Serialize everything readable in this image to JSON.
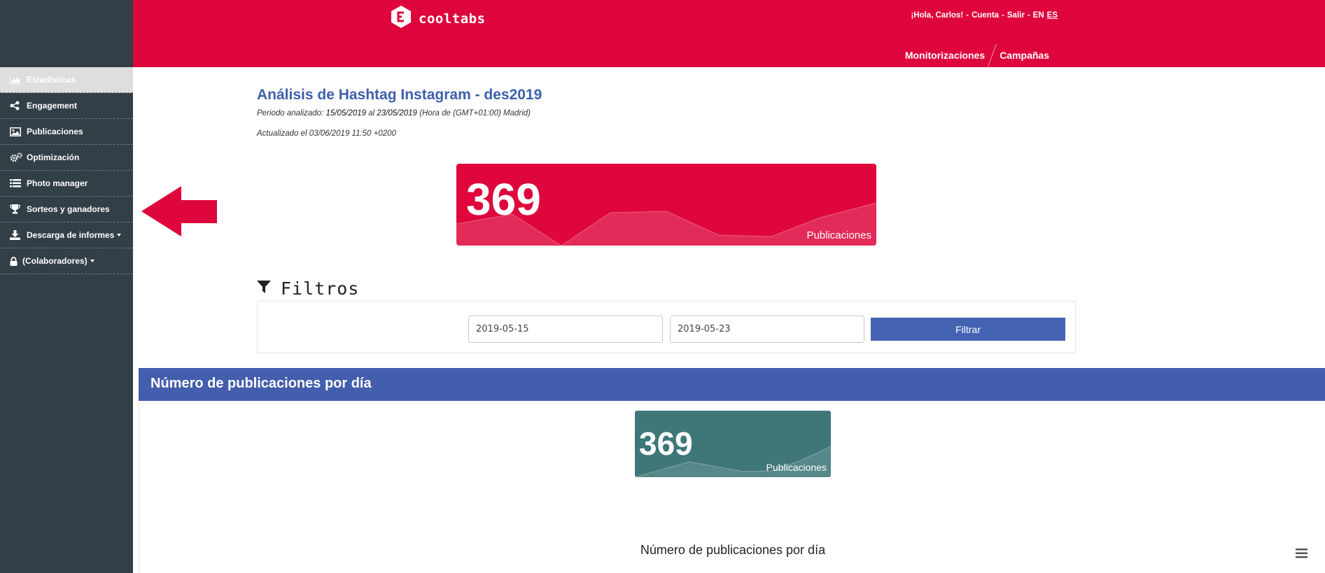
{
  "colors": {
    "sidebar": "#323f47",
    "header": "#de063c",
    "accent_blue": "#435eac",
    "card_red": "#de063c",
    "card_teal": "#3f7779"
  },
  "header": {
    "logo_text": "cooltabs",
    "greeting": "¡Hola, Carlos!",
    "account": "Cuenta",
    "logout": "Salir",
    "lang_en": "EN",
    "lang_es": "ES",
    "sep": "-",
    "tabs": [
      "Monitorizaciones",
      "Campañas"
    ]
  },
  "sidebar": {
    "items": [
      {
        "label": "Estadísticas",
        "icon": "area-chart-icon"
      },
      {
        "label": "Engagement",
        "icon": "share-icon"
      },
      {
        "label": "Publicaciones",
        "icon": "image-icon"
      },
      {
        "label": "Optimización",
        "icon": "gears-icon"
      },
      {
        "label": "Photo manager",
        "icon": "list-icon"
      },
      {
        "label": "Sorteos y ganadores",
        "icon": "trophy-icon"
      },
      {
        "label": "Descarga de informes",
        "icon": "download-icon"
      },
      {
        "label": "(Colaboradores)",
        "icon": "lock-icon"
      }
    ]
  },
  "main": {
    "title": "Análisis de Hashtag Instagram - des2019",
    "period_prefix": "Periodo analizado:",
    "period_from": "15/05/2019",
    "period_mid": "al",
    "period_to": "23/05/2019",
    "period_tz": "(Hora de (GMT+01:00) Madrid)",
    "updated": "Actualizado el 03/06/2019 11:50 +0200",
    "stat_card": {
      "value": "369",
      "label": "Publicaciones"
    },
    "filters": {
      "title": "Filtros",
      "date_from": "2019-05-15",
      "date_to": "2019-05-23",
      "button": "Filtrar"
    },
    "section": {
      "title": "Número de publicaciones por día",
      "stat_card": {
        "value": "369",
        "label": "Publicaciones"
      },
      "chart_title": "Número de publicaciones por día"
    }
  }
}
